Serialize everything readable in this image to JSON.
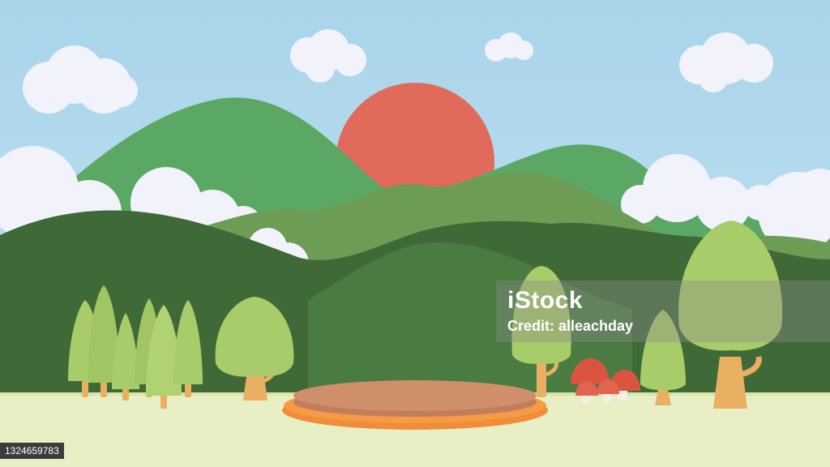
{
  "scene": {
    "colors": {
      "sky_top": "#a9d4ea",
      "sky_bottom": "#bfe2f3",
      "sun": "#e06b5a",
      "mountain_back": "#5aa864",
      "mountain_mid": "#6d9c55",
      "mountain_front": "#3f6a38",
      "ground": "#e9efc4",
      "cloud": "#f2f2fb",
      "podium_top": "#cf8f6a",
      "podium_rim": "#f59a45",
      "tree_foliage": "#a8cc6a",
      "tree_trunk": "#e9b063",
      "mushroom_cap": "#d9553f"
    },
    "icons": [
      "cloud-icon",
      "sun-icon",
      "mountain-icon",
      "pine-tree-icon",
      "round-tree-icon",
      "mushroom-icon",
      "podium-icon"
    ]
  },
  "watermark": {
    "brand": "iStock",
    "credit": "Credit: alleachday"
  },
  "image_id": "1324659783"
}
